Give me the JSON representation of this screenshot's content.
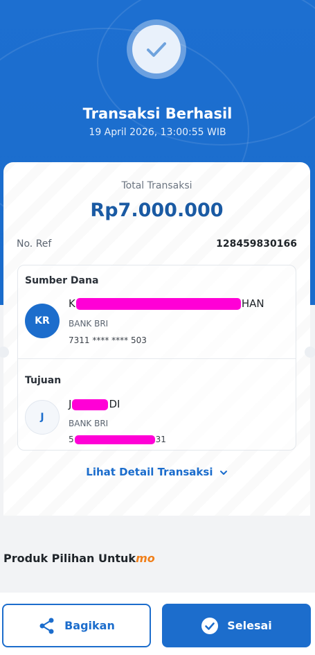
{
  "header": {
    "title": "Transaksi Berhasil",
    "datetime": "19 April 2026, 13:00:55 WIB"
  },
  "summary": {
    "total_label": "Total Transaksi",
    "total_amount": "Rp7.000.000",
    "ref_label": "No. Ref",
    "ref_value": "128459830166"
  },
  "source": {
    "section_label": "Sumber Dana",
    "initials": "KR",
    "name_start": "K",
    "name_end": "HAN",
    "bank": "BANK BRI",
    "account": "7311 **** **** 503"
  },
  "destination": {
    "section_label": "Tujuan",
    "initials": "J",
    "name_start": "J",
    "name_end": "DI",
    "bank": "BANK BRI",
    "account_start": "5",
    "account_end": "31"
  },
  "detail_link": "Lihat Detail Transaksi",
  "produk": {
    "title": "Produk Pilihan Untuk",
    "brand": "mo"
  },
  "actions": {
    "share_label": "Bagikan",
    "done_label": "Selesai"
  },
  "colors": {
    "primary": "#1c6dcc",
    "amount": "#1a5aa3",
    "redaction": "#ff00d6",
    "brand_orange": "#f07f1a"
  },
  "icons": {
    "success": "check-icon",
    "share": "share-icon",
    "done": "check-circle-icon",
    "chevron": "chevron-down-icon"
  }
}
